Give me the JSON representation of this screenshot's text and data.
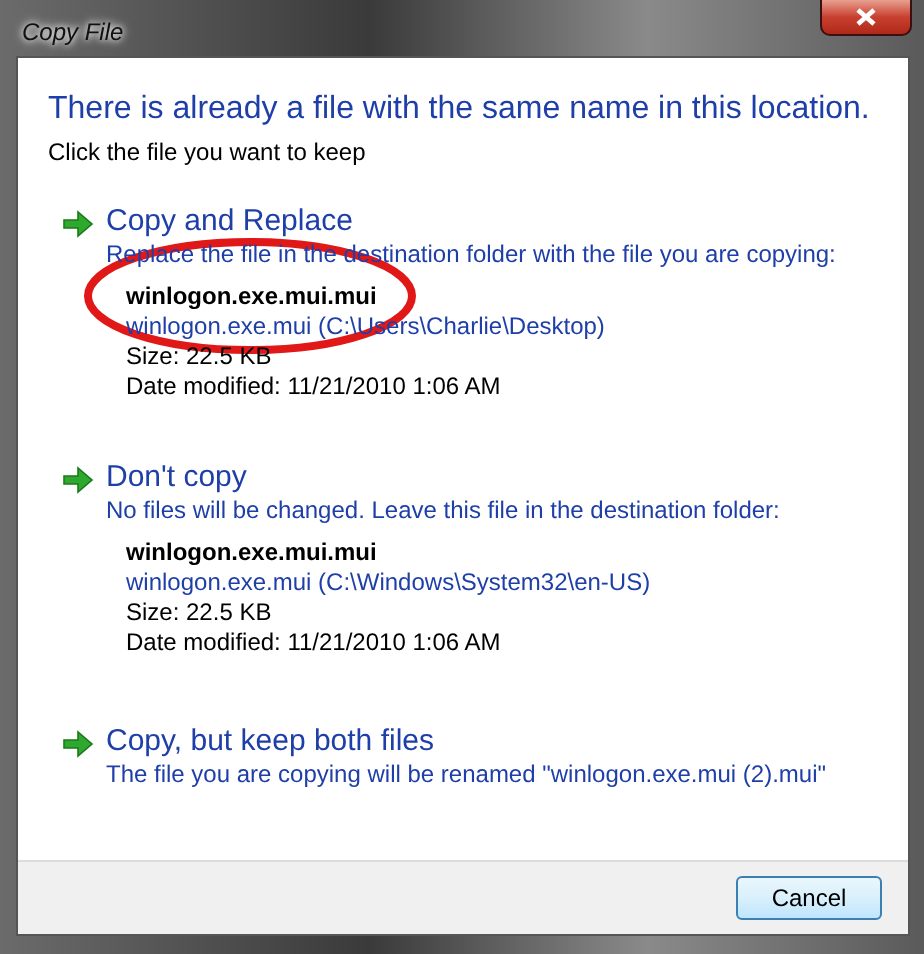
{
  "window": {
    "title": "Copy File"
  },
  "heading": "There is already a file with the same name in this location.",
  "instruction": "Click the file you want to keep",
  "options": [
    {
      "title": "Copy and Replace",
      "description": "Replace the file in the destination folder with the file you are copying:",
      "file": {
        "name": "winlogon.exe.mui.mui",
        "location": "winlogon.exe.mui (C:\\Users\\Charlie\\Desktop)",
        "size": "Size: 22.5 KB",
        "modified": "Date modified: 11/21/2010 1:06 AM"
      }
    },
    {
      "title": "Don't copy",
      "description": "No files will be changed. Leave this file in the destination folder:",
      "file": {
        "name": "winlogon.exe.mui.mui",
        "location": "winlogon.exe.mui (C:\\Windows\\System32\\en-US)",
        "size": "Size: 22.5 KB",
        "modified": "Date modified: 11/21/2010 1:06 AM"
      }
    },
    {
      "title": "Copy, but keep both files",
      "description": "The file you are copying will be renamed \"winlogon.exe.mui (2).mui\""
    }
  ],
  "buttons": [
    "Cancel"
  ]
}
